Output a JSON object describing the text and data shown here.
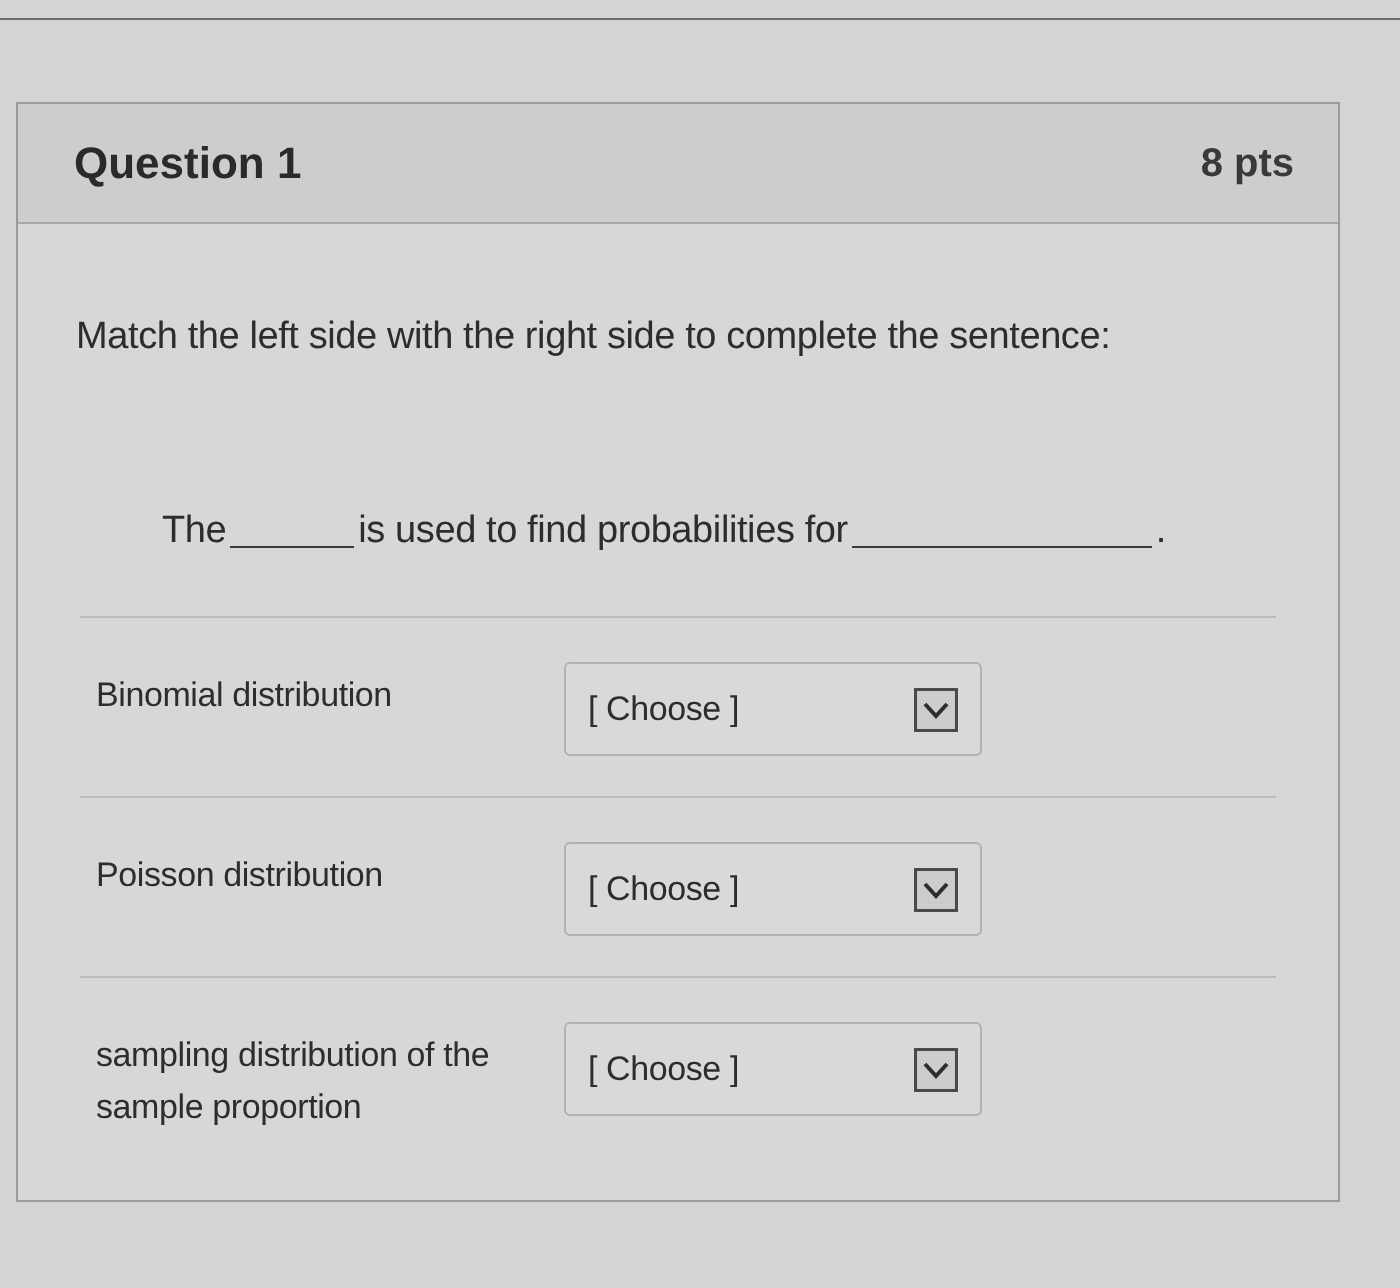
{
  "question": {
    "title": "Question 1",
    "points": "8 pts"
  },
  "prompt": "Match the left side with the right side to complete the sentence:",
  "sentence": [
    {
      "kind": "text",
      "text": "The"
    },
    {
      "kind": "blank"
    },
    {
      "kind": "text",
      "text": "is used to find probabilities for"
    },
    {
      "kind": "blank"
    },
    {
      "kind": "text",
      "text": "."
    }
  ],
  "matches": [
    {
      "label": "Binomial distribution",
      "dropdown": {
        "value": "[ Choose ]"
      }
    },
    {
      "label": "Poisson distribution",
      "dropdown": {
        "value": "[ Choose ]"
      }
    },
    {
      "label": "sampling distribution of the sample proportion",
      "dropdown": {
        "value": "[ Choose ]"
      }
    }
  ]
}
